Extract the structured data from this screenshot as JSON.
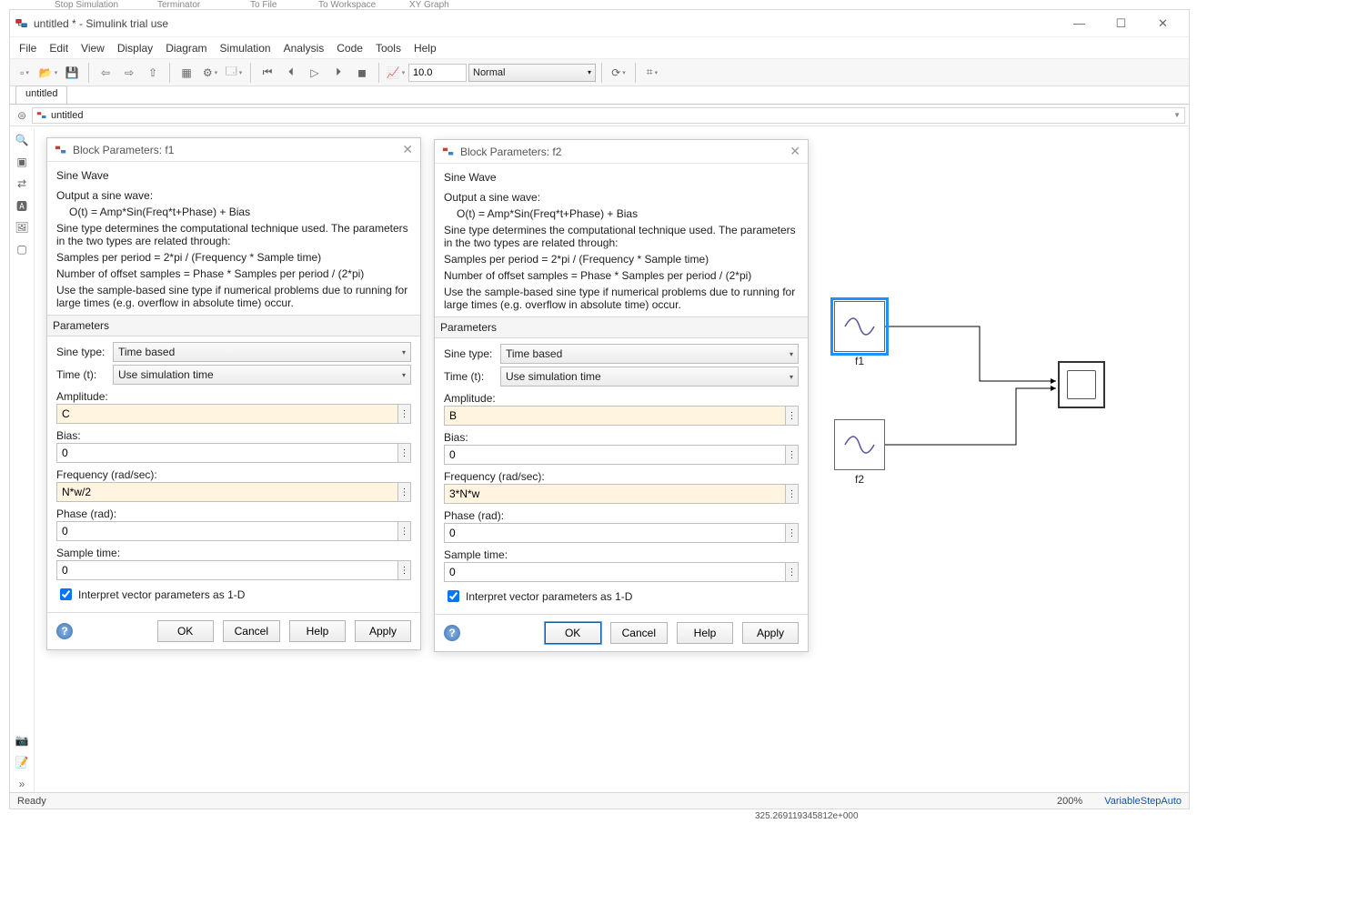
{
  "window": {
    "title": "untitled * - Simulink trial use",
    "min_tip": "Minimize",
    "max_tip": "Maximize",
    "close_tip": "Close"
  },
  "menus": [
    "File",
    "Edit",
    "View",
    "Display",
    "Diagram",
    "Simulation",
    "Analysis",
    "Code",
    "Tools",
    "Help"
  ],
  "toolbar": {
    "stop_time": "10.0",
    "sim_mode": "Normal"
  },
  "tabs": {
    "active": "untitled"
  },
  "explorer": {
    "path": "untitled"
  },
  "dialogs": [
    {
      "id": "f1",
      "title": "Block Parameters: f1",
      "block_type": "Sine Wave",
      "desc1": "Output a sine wave:",
      "formula": "O(t) = Amp*Sin(Freq*t+Phase) + Bias",
      "desc2": "Sine type determines the computational technique used. The parameters in the two types are related through:",
      "desc3": "Samples per period = 2*pi / (Frequency * Sample time)",
      "desc4": "Number of offset samples = Phase * Samples per period / (2*pi)",
      "desc5": "Use the sample-based sine type if numerical problems due to running for large times (e.g. overflow in absolute time) occur.",
      "parameters_header": "Parameters",
      "sine_type_label": "Sine type:",
      "sine_type": "Time based",
      "time_label": "Time (t):",
      "time": "Use simulation time",
      "amplitude_label": "Amplitude:",
      "amplitude": "C",
      "bias_label": "Bias:",
      "bias": "0",
      "freq_label": "Frequency (rad/sec):",
      "freq": "N*w/2",
      "phase_label": "Phase (rad):",
      "phase": "0",
      "sample_label": "Sample time:",
      "sample": "0",
      "interpret_label": "Interpret vector parameters as 1-D",
      "interpret_checked": true,
      "buttons": {
        "ok": "OK",
        "cancel": "Cancel",
        "help": "Help",
        "apply": "Apply"
      },
      "ok_primary": false
    },
    {
      "id": "f2",
      "title": "Block Parameters: f2",
      "block_type": "Sine Wave",
      "desc1": "Output a sine wave:",
      "formula": "O(t) = Amp*Sin(Freq*t+Phase) + Bias",
      "desc2": "Sine type determines the computational technique used. The parameters in the two types are related through:",
      "desc3": "Samples per period = 2*pi / (Frequency * Sample time)",
      "desc4": "Number of offset samples = Phase * Samples per period / (2*pi)",
      "desc5": "Use the sample-based sine type if numerical problems due to running for large times (e.g. overflow in absolute time) occur.",
      "parameters_header": "Parameters",
      "sine_type_label": "Sine type:",
      "sine_type": "Time based",
      "time_label": "Time (t):",
      "time": "Use simulation time",
      "amplitude_label": "Amplitude:",
      "amplitude": "B",
      "bias_label": "Bias:",
      "bias": "0",
      "freq_label": "Frequency (rad/sec):",
      "freq": "3*N*w",
      "phase_label": "Phase (rad):",
      "phase": "0",
      "sample_label": "Sample time:",
      "sample": "0",
      "interpret_label": "Interpret vector parameters as 1-D",
      "interpret_checked": true,
      "buttons": {
        "ok": "OK",
        "cancel": "Cancel",
        "help": "Help",
        "apply": "Apply"
      },
      "ok_primary": true
    }
  ],
  "model": {
    "blocks": {
      "f1": "f1",
      "f2": "f2"
    }
  },
  "status": {
    "ready": "Ready",
    "zoom": "200%",
    "solver": "VariableStepAuto"
  },
  "bg": {
    "top_labels": [
      "Stop Simulation",
      "Terminator",
      "To File",
      "To Workspace",
      "XY Graph"
    ],
    "bottom_number": "325.269119345812e+000"
  }
}
